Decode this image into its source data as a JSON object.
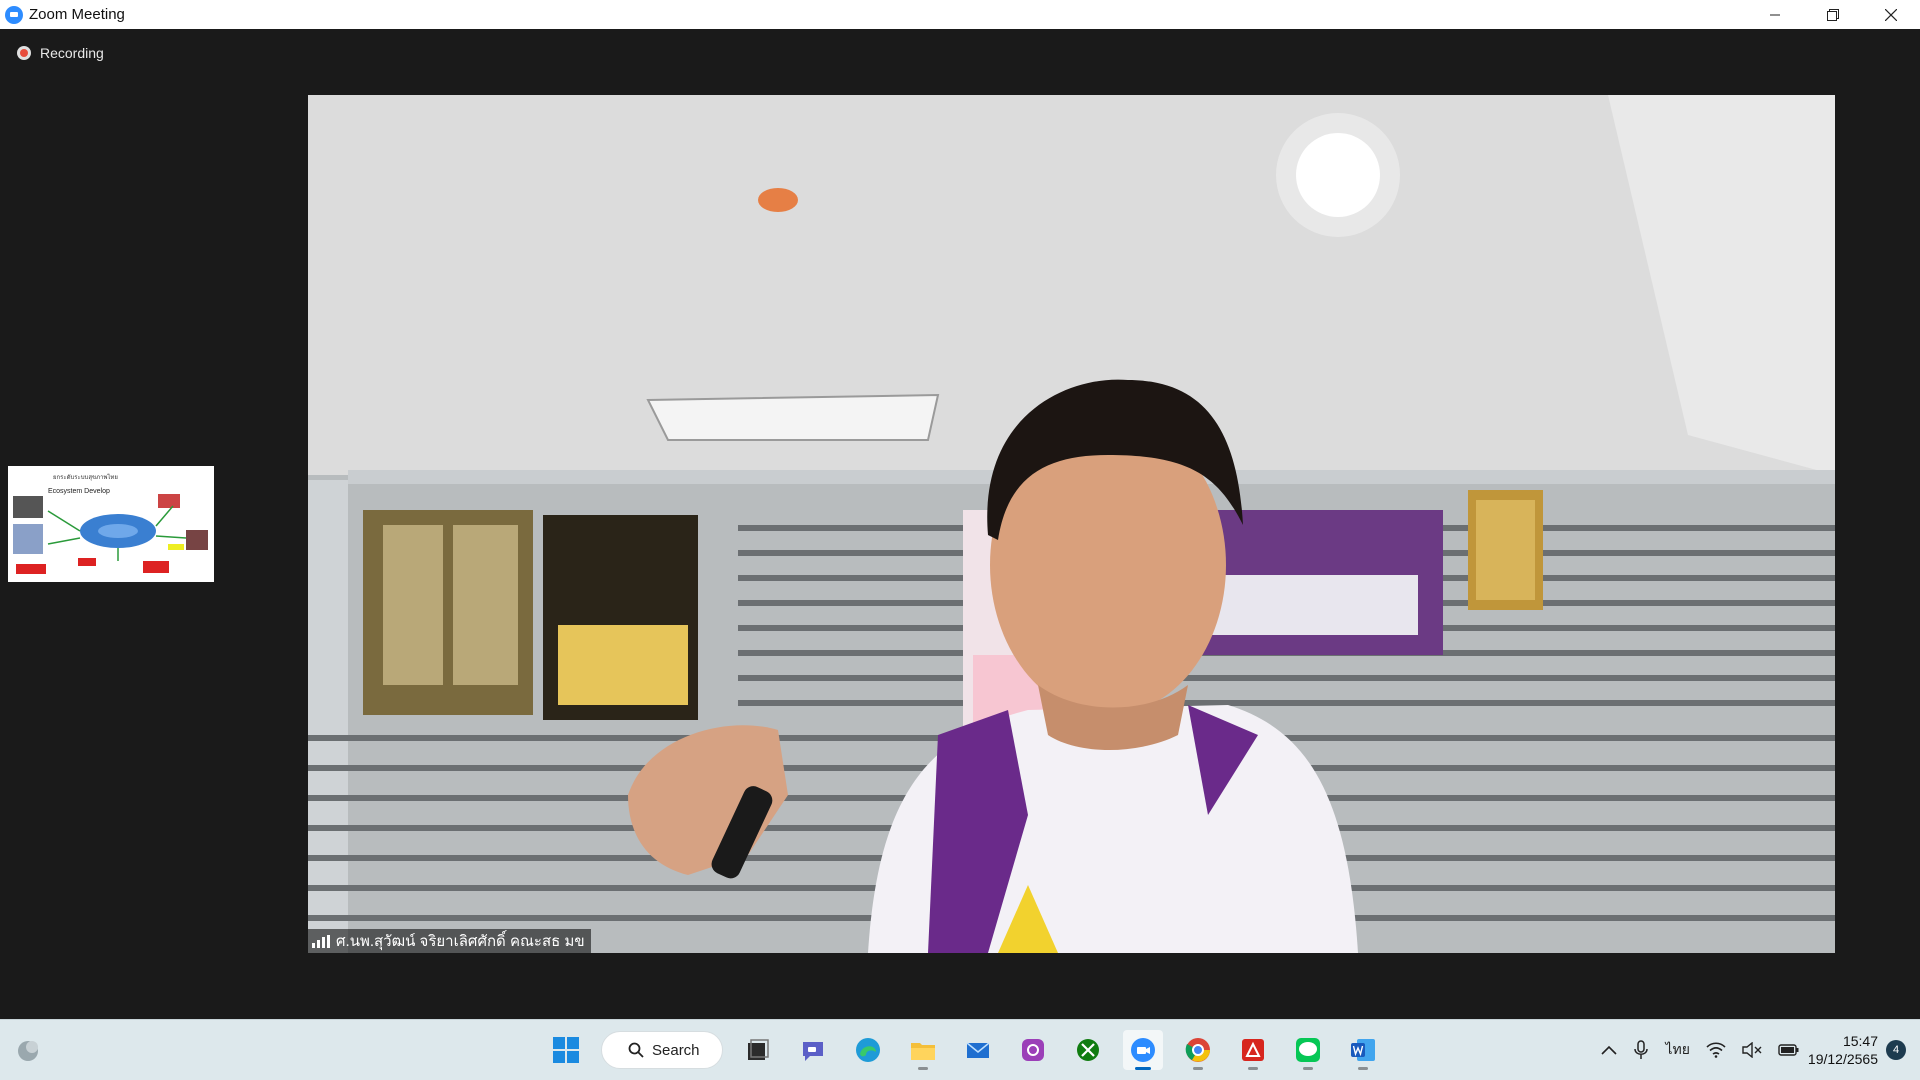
{
  "window": {
    "title": "Zoom Meeting",
    "controls": {
      "minimize": "minimize-icon",
      "restore": "restore-icon",
      "close": "close-icon"
    }
  },
  "meeting": {
    "recording_label": "Recording",
    "shared_screen_thumbnail": {
      "title": "ยกระดับระบบสุขภาพไทย",
      "heading": "Ecosystem Develop"
    },
    "active_speaker": {
      "name": "ศ.นพ.สุวัฒน์ จริยาเลิศศักดิ์ คณะสธ มข"
    }
  },
  "taskbar": {
    "search_label": "Search",
    "apps": [
      {
        "name": "start-button",
        "icon": "windows-logo-icon"
      },
      {
        "name": "task-view-button",
        "icon": "task-view-icon"
      },
      {
        "name": "teams-chat-button",
        "icon": "chat-icon"
      },
      {
        "name": "edge-button",
        "icon": "edge-icon"
      },
      {
        "name": "file-explorer-button",
        "icon": "folder-icon"
      },
      {
        "name": "mail-button",
        "icon": "mail-icon"
      },
      {
        "name": "app-button",
        "icon": "camera-app-icon"
      },
      {
        "name": "xbox-button",
        "icon": "xbox-icon"
      },
      {
        "name": "zoom-button",
        "icon": "zoom-icon",
        "active": true
      },
      {
        "name": "chrome-button",
        "icon": "chrome-icon"
      },
      {
        "name": "acrobat-button",
        "icon": "acrobat-icon"
      },
      {
        "name": "line-button",
        "icon": "line-icon"
      },
      {
        "name": "word-button",
        "icon": "word-icon"
      }
    ],
    "tray": {
      "language": "ไทย",
      "time": "15:47",
      "date": "19/12/2565",
      "notifications": "4"
    }
  },
  "colors": {
    "accent": "#0067c0",
    "zoom_blue": "#2d8cff",
    "recording_red": "#e74c3c",
    "meeting_bg": "#1a1a1a",
    "taskbar_bg": "#dde8ec"
  }
}
